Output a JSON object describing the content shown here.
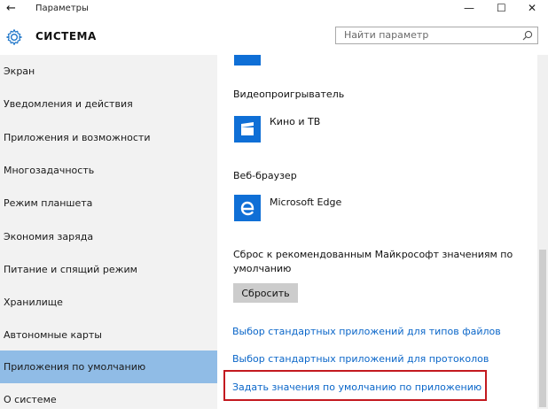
{
  "window": {
    "back_glyph": "←",
    "title": "Параметры",
    "minimize": "—",
    "maximize": "☐",
    "close": "✕"
  },
  "header": {
    "title": "СИСТЕМА",
    "search_placeholder": "Найти параметр",
    "search_icon": "search-icon",
    "settings_icon": "gear-icon"
  },
  "sidebar": {
    "selected_index": 9,
    "items": [
      {
        "label": "Экран"
      },
      {
        "label": "Уведомления и действия"
      },
      {
        "label": "Приложения и возможности"
      },
      {
        "label": "Многозадачность"
      },
      {
        "label": "Режим планшета"
      },
      {
        "label": "Экономия заряда"
      },
      {
        "label": "Питание и спящий режим"
      },
      {
        "label": "Хранилище"
      },
      {
        "label": "Автономные карты"
      },
      {
        "label": "Приложения по умолчанию"
      },
      {
        "label": "О системе"
      }
    ]
  },
  "main": {
    "video_title": "Видеопроигрыватель",
    "video_app": "Кино и ТВ",
    "browser_title": "Веб-браузер",
    "browser_app": "Microsoft Edge",
    "reset_text": "Сброс к рекомендованным Майкрософт значениям по умолчанию",
    "reset_button": "Сбросить",
    "links": [
      "Выбор стандартных приложений для типов файлов",
      "Выбор стандартных приложений для протоколов",
      "Задать значения по умолчанию по приложению"
    ]
  },
  "colors": {
    "accent": "#0f6fd6",
    "selection": "#90bce6",
    "link": "#0a66c9",
    "highlight": "#c3191f"
  }
}
